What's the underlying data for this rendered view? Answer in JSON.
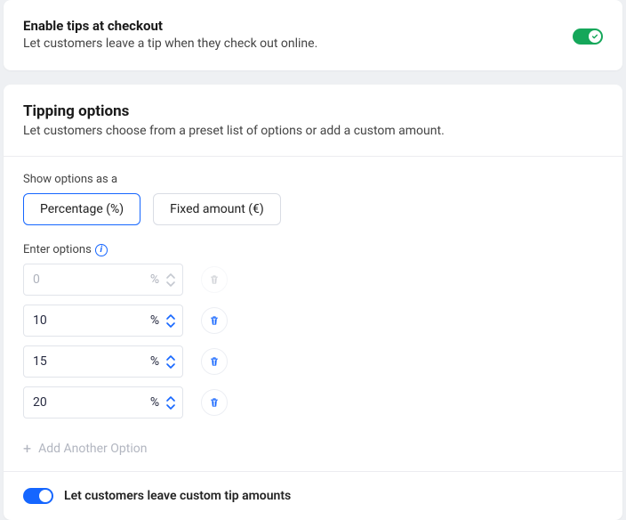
{
  "enableCard": {
    "title": "Enable tips at checkout",
    "subtitle": "Let customers leave a tip when they check out online.",
    "toggleOn": true
  },
  "optionsCard": {
    "title": "Tipping options",
    "subtitle": "Let customers choose from a preset list of options or add a custom amount.",
    "showAsLabel": "Show options as a",
    "percentageLabel": "Percentage (%)",
    "fixedLabel": "Fixed amount (€)",
    "enterOptionsLabel": "Enter options",
    "unit": "%",
    "options": [
      {
        "value": "0",
        "enabled": false
      },
      {
        "value": "10",
        "enabled": true
      },
      {
        "value": "15",
        "enabled": true
      },
      {
        "value": "20",
        "enabled": true
      }
    ],
    "addAnotherLabel": "Add Another Option",
    "customTip": {
      "label": "Let customers leave custom tip amounts",
      "toggleOn": true
    }
  }
}
